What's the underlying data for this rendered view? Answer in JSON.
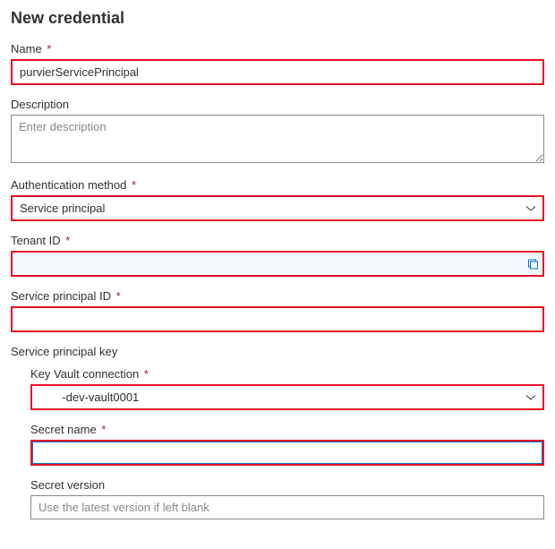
{
  "title": "New credential",
  "fields": {
    "name": {
      "label": "Name",
      "value": "purvierServicePrincipal"
    },
    "description": {
      "label": "Description",
      "placeholder": "Enter description"
    },
    "authMethod": {
      "label": "Authentication method",
      "value": "Service principal"
    },
    "tenantId": {
      "label": "Tenant ID",
      "value": ""
    },
    "spId": {
      "label": "Service principal ID",
      "value": ""
    },
    "spKeySection": "Service principal key",
    "keyVault": {
      "label": "Key Vault connection",
      "value": "       -dev-vault0001"
    },
    "secretName": {
      "label": "Secret name",
      "value": ""
    },
    "secretVersion": {
      "label": "Secret version",
      "placeholder": "Use the latest version if left blank"
    }
  },
  "asterisk": "*"
}
